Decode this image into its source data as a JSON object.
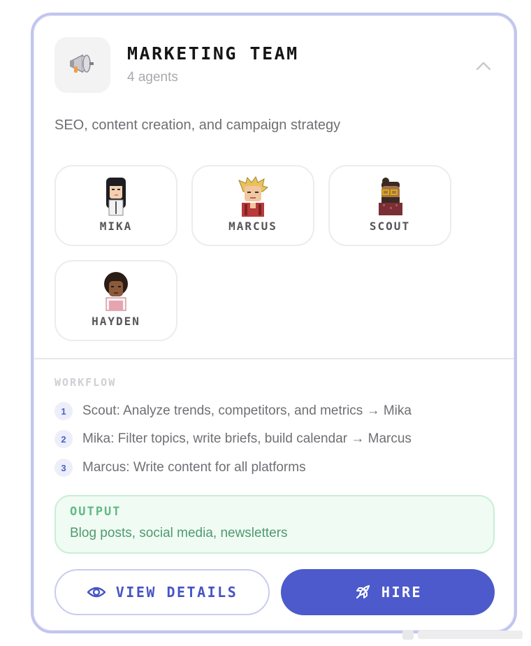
{
  "team": {
    "icon": "megaphone-icon",
    "title": "MARKETING TEAM",
    "count": "4 agents",
    "description": "SEO, content creation, and campaign strategy",
    "collapse_icon": "chevron-up-icon"
  },
  "agents": [
    {
      "name": "MIKA"
    },
    {
      "name": "MARCUS"
    },
    {
      "name": "SCOUT"
    },
    {
      "name": "HAYDEN"
    }
  ],
  "workflow": {
    "title": "WORKFLOW",
    "steps": [
      {
        "number": "1",
        "text": "Scout: Analyze trends, competitors, and metrics → Mika"
      },
      {
        "number": "2",
        "text": "Mika: Filter topics, write briefs, build calendar → Marcus"
      },
      {
        "number": "3",
        "text": "Marcus: Write content for all platforms"
      }
    ]
  },
  "output": {
    "label": "OUTPUT",
    "text": "Blog posts, social media, newsletters"
  },
  "actions": {
    "details_label": "VIEW DETAILS",
    "details_icon": "eye-icon",
    "hire_label": "HIRE",
    "hire_icon": "rocket-icon"
  },
  "colors": {
    "accent": "#4d5acb",
    "card_border": "#c2c5ee",
    "output_bg": "#f0fbf4",
    "output_text": "#4f9a6e"
  }
}
